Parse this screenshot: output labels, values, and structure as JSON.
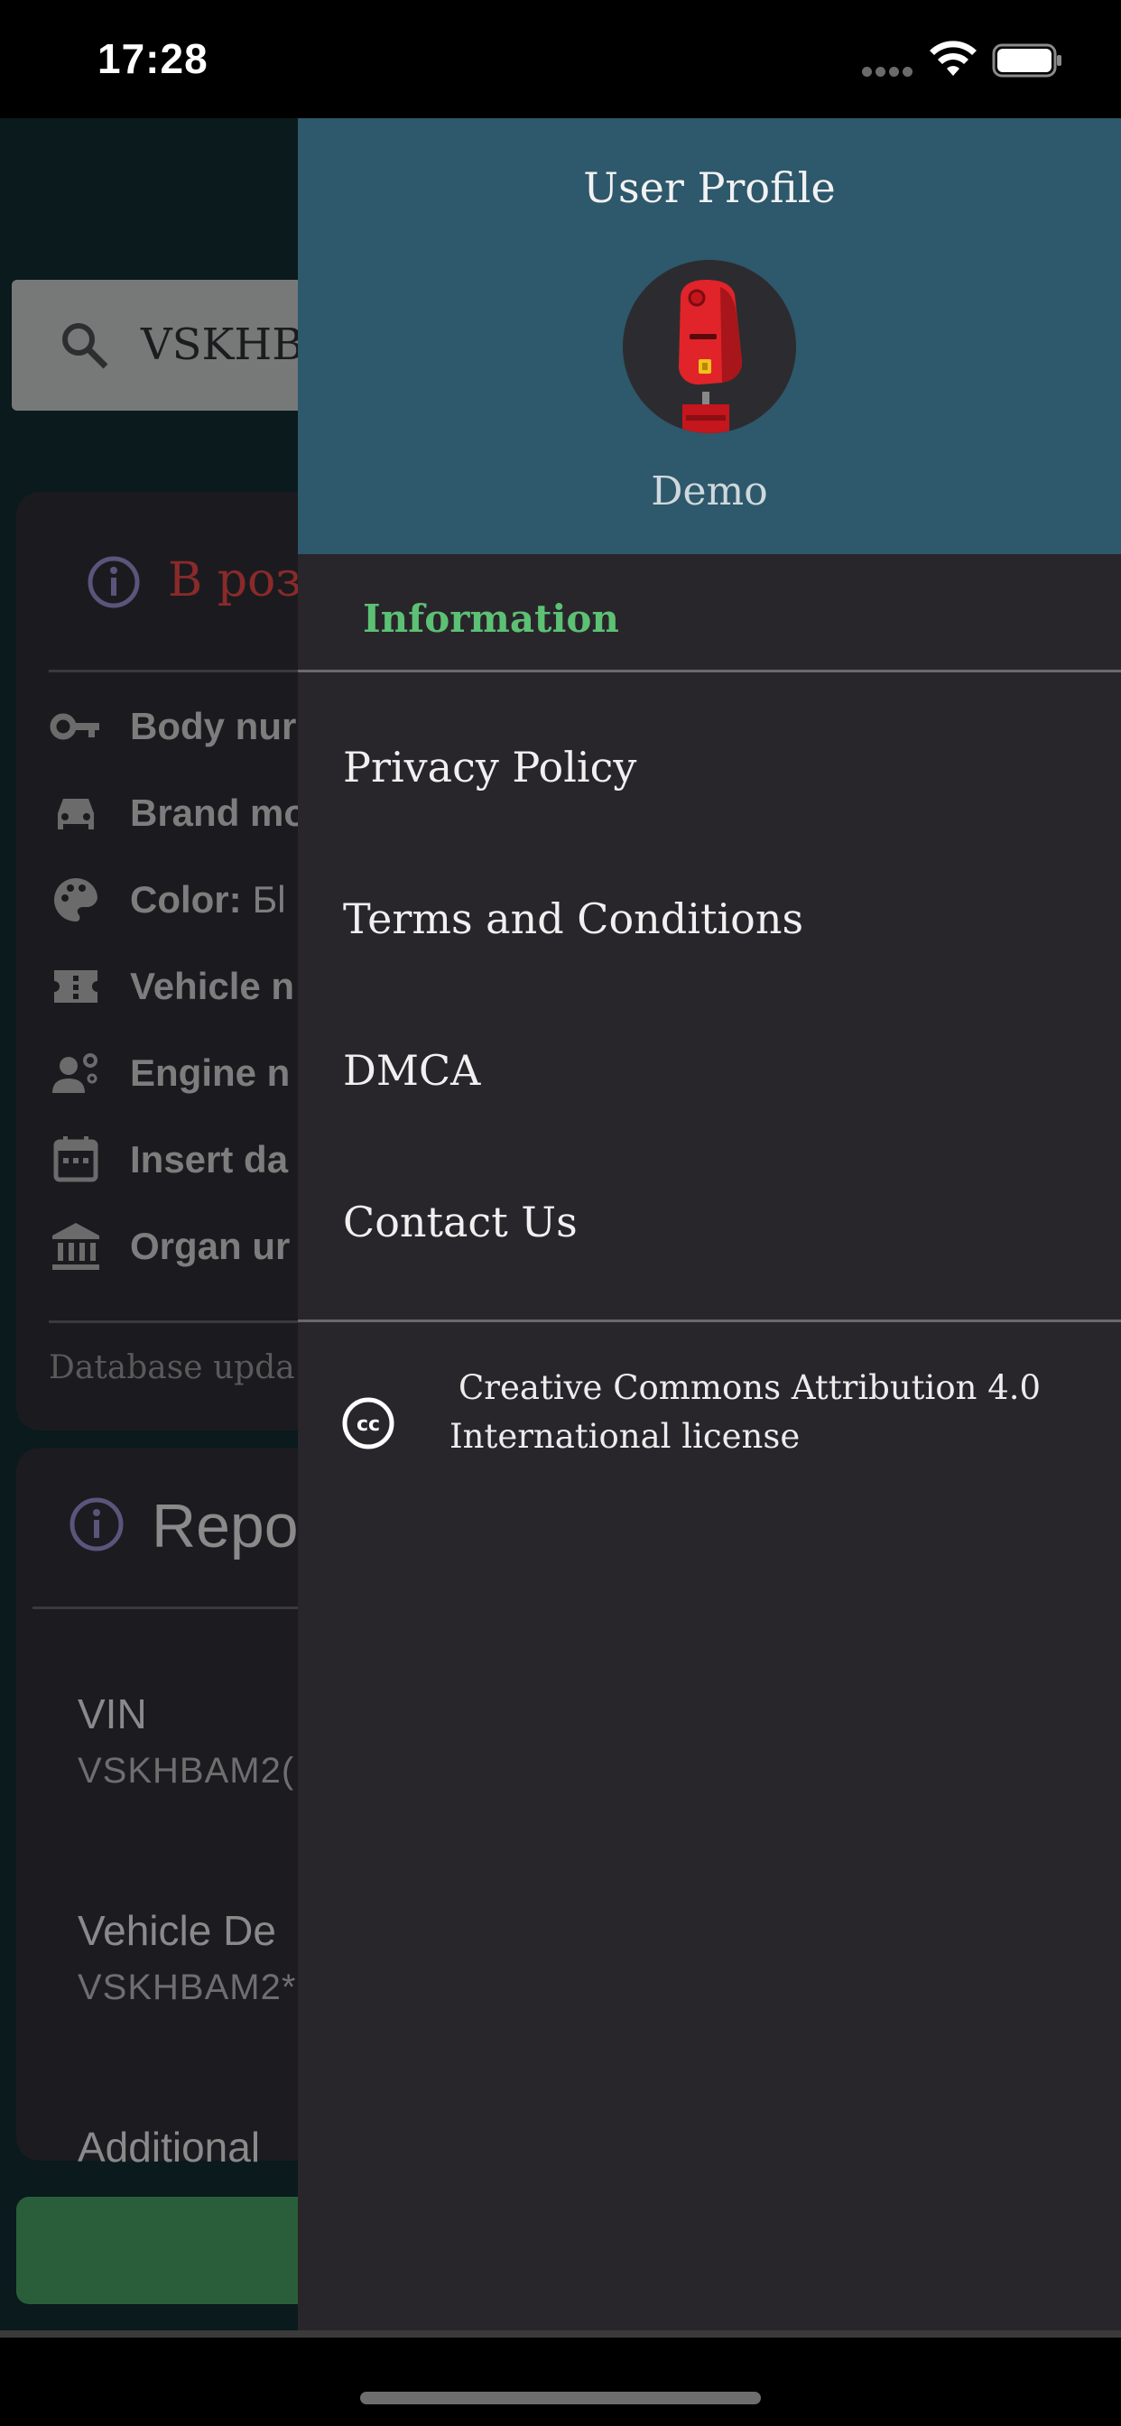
{
  "status_bar": {
    "time": "17:28"
  },
  "background": {
    "search": {
      "value": "VSKHB"
    },
    "notice": {
      "text": "В роз"
    },
    "fields": [
      {
        "icon": "key-icon",
        "label": "Body nur",
        "value": ""
      },
      {
        "icon": "car-icon",
        "label": "Brand mo",
        "value": ""
      },
      {
        "icon": "palette-icon",
        "label": "Color:",
        "value": "Бl"
      },
      {
        "icon": "ticket-icon",
        "label": "Vehicle n",
        "value": ""
      },
      {
        "icon": "engineer-icon",
        "label": "Engine n",
        "value": ""
      },
      {
        "icon": "calendar-icon",
        "label": "Insert da",
        "value": ""
      },
      {
        "icon": "bank-icon",
        "label": "Organ ur",
        "value": ""
      }
    ],
    "db_update": "Database upda",
    "report": {
      "title": "Repo",
      "vin_label": "VIN",
      "vin_value": "VSKHBAM2(",
      "desc_label": "Vehicle De",
      "desc_value": "VSKHBAM2*",
      "additional_label": "Additional"
    }
  },
  "drawer": {
    "header": {
      "title": "User Profile",
      "user_name": "Demo"
    },
    "section_label": "Information",
    "menu": [
      {
        "label": "Privacy Policy"
      },
      {
        "label": "Terms and Conditions"
      },
      {
        "label": "DMCA"
      },
      {
        "label": "Contact Us"
      }
    ],
    "license": {
      "line1": "Creative Commons Attribution 4.0",
      "line2": "International license"
    }
  }
}
